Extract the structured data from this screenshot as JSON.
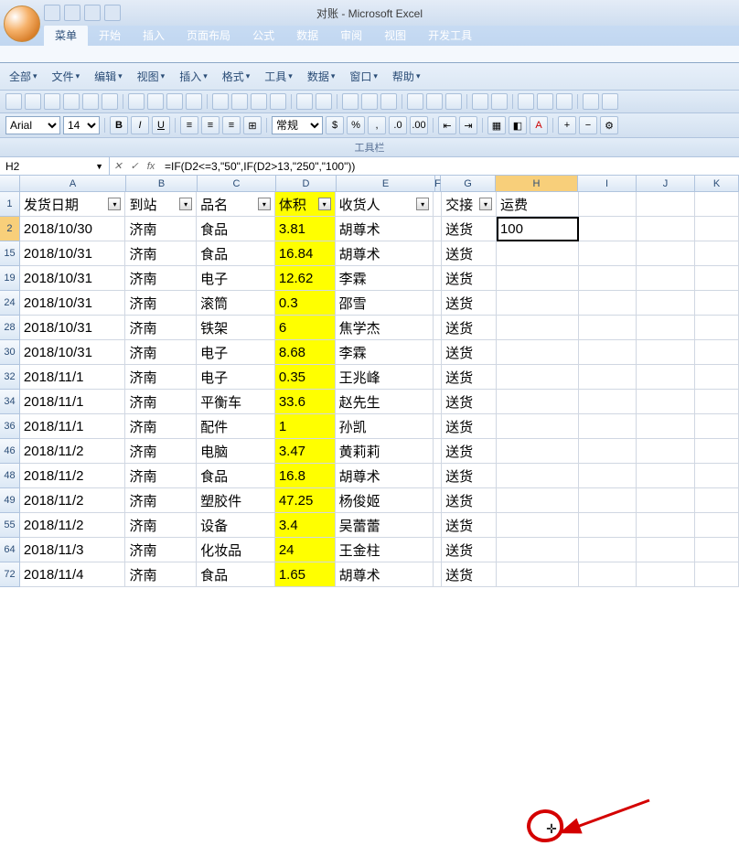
{
  "window": {
    "title": "对账 - Microsoft Excel"
  },
  "ribbon": {
    "tabs": [
      "菜单",
      "开始",
      "插入",
      "页面布局",
      "公式",
      "数据",
      "审阅",
      "视图",
      "开发工具"
    ],
    "active": 0
  },
  "menu2": [
    "全部",
    "文件",
    "编辑",
    "视图",
    "插入",
    "格式",
    "工具",
    "数据",
    "窗口",
    "帮助"
  ],
  "font": {
    "name": "Arial",
    "size": "14",
    "style_label": "常规"
  },
  "toolbar_label": "工具栏",
  "formula": {
    "name_box": "H2",
    "fx": "fx",
    "value": "=IF(D2<=3,\"50\",IF(D2>13,\"250\",\"100\"))"
  },
  "columns": [
    "A",
    "B",
    "C",
    "D",
    "E",
    "F",
    "G",
    "H",
    "I",
    "J",
    "K"
  ],
  "headers": {
    "A": "发货日期",
    "B": "到站",
    "C": "品名",
    "D": "体积",
    "E": "收货人",
    "G": "交接",
    "H": "运费"
  },
  "selected_cell": "H2",
  "h2_value": "100",
  "rows": [
    {
      "n": "2",
      "A": "2018/10/30",
      "B": "济南",
      "C": "食品",
      "D": "3.81",
      "E": "胡尊术",
      "G": "送货"
    },
    {
      "n": "15",
      "A": "2018/10/31",
      "B": "济南",
      "C": "食品",
      "D": "16.84",
      "E": "胡尊术",
      "G": "送货"
    },
    {
      "n": "19",
      "A": "2018/10/31",
      "B": "济南",
      "C": "电子",
      "D": "12.62",
      "E": "李霖",
      "G": "送货"
    },
    {
      "n": "24",
      "A": "2018/10/31",
      "B": "济南",
      "C": "滚筒",
      "D": "0.3",
      "E": "邵雪",
      "G": "送货"
    },
    {
      "n": "28",
      "A": "2018/10/31",
      "B": "济南",
      "C": "铁架",
      "D": "6",
      "E": "焦学杰",
      "G": "送货"
    },
    {
      "n": "30",
      "A": "2018/10/31",
      "B": "济南",
      "C": "电子",
      "D": "8.68",
      "E": "李霖",
      "G": "送货"
    },
    {
      "n": "32",
      "A": "2018/11/1",
      "B": "济南",
      "C": "电子",
      "D": "0.35",
      "E": "王兆峰",
      "G": "送货"
    },
    {
      "n": "34",
      "A": "2018/11/1",
      "B": "济南",
      "C": "平衡车",
      "D": "33.6",
      "E": "赵先生",
      "G": "送货"
    },
    {
      "n": "36",
      "A": "2018/11/1",
      "B": "济南",
      "C": "配件",
      "D": "1",
      "E": "孙凯",
      "G": "送货"
    },
    {
      "n": "46",
      "A": "2018/11/2",
      "B": "济南",
      "C": "电脑",
      "D": "3.47",
      "E": "黄莉莉",
      "G": "送货"
    },
    {
      "n": "48",
      "A": "2018/11/2",
      "B": "济南",
      "C": "食品",
      "D": "16.8",
      "E": "胡尊术",
      "G": "送货"
    },
    {
      "n": "49",
      "A": "2018/11/2",
      "B": "济南",
      "C": "塑胶件",
      "D": "47.25",
      "E": "杨俊姬",
      "G": "送货"
    },
    {
      "n": "55",
      "A": "2018/11/2",
      "B": "济南",
      "C": "设备",
      "D": "3.4",
      "E": "吴蕾蕾",
      "G": "送货"
    },
    {
      "n": "64",
      "A": "2018/11/3",
      "B": "济南",
      "C": "化妆品",
      "D": "24",
      "E": "王金柱",
      "G": "送货"
    },
    {
      "n": "72",
      "A": "2018/11/4",
      "B": "济南",
      "C": "食品",
      "D": "1.65",
      "E": "胡尊术",
      "G": "送货"
    }
  ]
}
